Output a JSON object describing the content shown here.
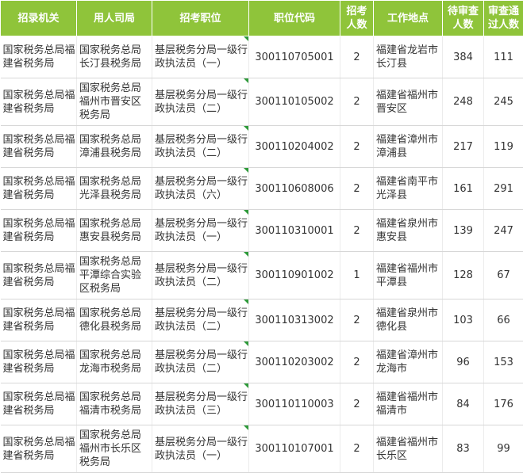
{
  "headers": [
    "招录机关",
    "用人司局",
    "招考职位",
    "职位代码",
    "招考人数",
    "工作地点",
    "待审查人数",
    "审查通过人数"
  ],
  "rows": [
    {
      "agency": "国家税务总局福建省税务局",
      "bureau": "国家税务总局长汀县税务局",
      "position": "基层税务分局一级行政执法员（一）",
      "code": "300110705001",
      "count": "2",
      "location": "福建省龙岩市长汀县",
      "pending": "384",
      "passed": "111"
    },
    {
      "agency": "国家税务总局福建省税务局",
      "bureau": "国家税务总局福州市晋安区税务局",
      "position": "基层税务分局一级行政执法员（二）",
      "code": "300110105002",
      "count": "2",
      "location": "福建省福州市晋安区",
      "pending": "248",
      "passed": "245"
    },
    {
      "agency": "国家税务总局福建省税务局",
      "bureau": "国家税务总局漳浦县税务局",
      "position": "基层税务分局一级行政执法员（二）",
      "code": "300110204002",
      "count": "2",
      "location": "福建省漳州市漳浦县",
      "pending": "217",
      "passed": "119"
    },
    {
      "agency": "国家税务总局福建省税务局",
      "bureau": "国家税务总局光泽县税务局",
      "position": "基层税务分局一级行政执法员（六）",
      "code": "300110608006",
      "count": "2",
      "location": "福建省南平市光泽县",
      "pending": "161",
      "passed": "291"
    },
    {
      "agency": "国家税务总局福建省税务局",
      "bureau": "国家税务总局惠安县税务局",
      "position": "基层税务分局一级行政执法员（一）",
      "code": "300110310001",
      "count": "2",
      "location": "福建省泉州市惠安县",
      "pending": "139",
      "passed": "247"
    },
    {
      "agency": "国家税务总局福建省税务局",
      "bureau": "国家税务总局平潭综合实验区税务局",
      "position": "基层税务分局一级行政执法员（二）",
      "code": "300110901002",
      "count": "1",
      "location": "福建省福州市平潭县",
      "pending": "128",
      "passed": "67"
    },
    {
      "agency": "国家税务总局福建省税务局",
      "bureau": "国家税务总局德化县税务局",
      "position": "基层税务分局一级行政执法员（二）",
      "code": "300110313002",
      "count": "2",
      "location": "福建省泉州市德化县",
      "pending": "103",
      "passed": "66"
    },
    {
      "agency": "国家税务总局福建省税务局",
      "bureau": "国家税务总局龙海市税务局",
      "position": "基层税务分局一级行政执法员（二）",
      "code": "300110203002",
      "count": "2",
      "location": "福建省漳州市龙海市",
      "pending": "96",
      "passed": "153"
    },
    {
      "agency": "国家税务总局福建省税务局",
      "bureau": "国家税务总局福清市税务局",
      "position": "基层税务分局一级行政执法员（三）",
      "code": "300110110003",
      "count": "2",
      "location": "福建省福州市福清市",
      "pending": "84",
      "passed": "176"
    },
    {
      "agency": "国家税务总局福建省税务局",
      "bureau": "国家税务总局福州市长乐区税务局",
      "position": "基层税务分局一级行政执法员（一）",
      "code": "300110107001",
      "count": "2",
      "location": "福建省福州市长乐区",
      "pending": "83",
      "passed": "99"
    }
  ]
}
